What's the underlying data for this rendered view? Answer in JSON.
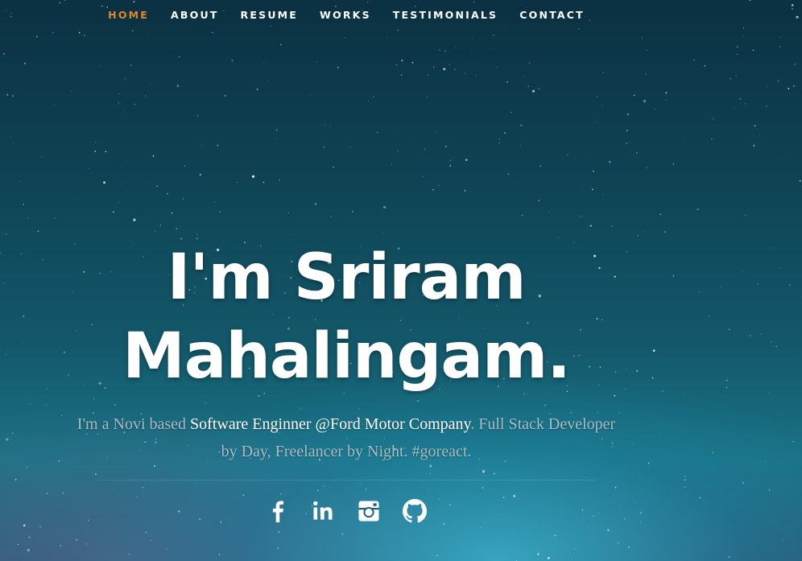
{
  "nav": {
    "items": [
      {
        "label": "HOME",
        "active": true
      },
      {
        "label": "ABOUT",
        "active": false
      },
      {
        "label": "RESUME",
        "active": false
      },
      {
        "label": "WORKS",
        "active": false
      },
      {
        "label": "TESTIMONIALS",
        "active": false
      },
      {
        "label": "CONTACT",
        "active": false
      }
    ],
    "active_color": "#e2852a"
  },
  "banner": {
    "headline_line1": "I'm Sriram",
    "headline_line2": "Mahalingam.",
    "intro_prefix": "I'm a Novi based",
    "intro_highlight": "Software Enginner @Ford Motor Company",
    "intro_suffix": ". Full Stack Developer by Day, Freelancer by Night. #goreact."
  },
  "social": [
    {
      "icon": "facebook-icon"
    },
    {
      "icon": "linkedin-icon"
    },
    {
      "icon": "instagram-icon"
    },
    {
      "icon": "github-icon"
    }
  ]
}
